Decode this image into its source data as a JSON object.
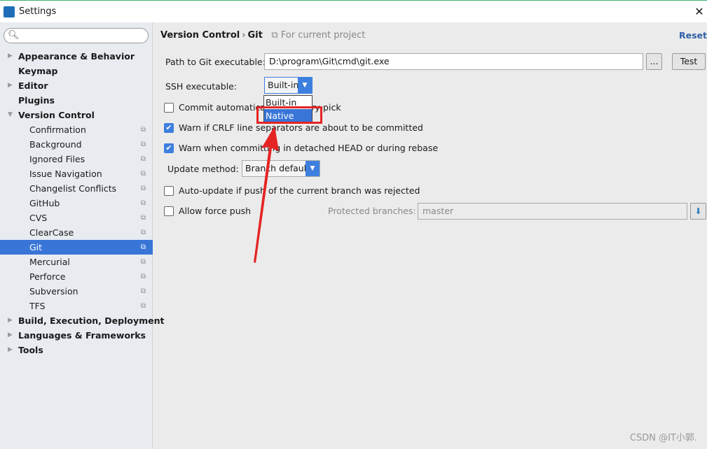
{
  "window": {
    "title": "Settings",
    "logo": "JI"
  },
  "search": {
    "placeholder": ""
  },
  "sidebar": {
    "items": [
      {
        "label": "Appearance & Behavior",
        "level": 0,
        "expand": "collapsed"
      },
      {
        "label": "Keymap",
        "level": 0
      },
      {
        "label": "Editor",
        "level": 0,
        "expand": "collapsed"
      },
      {
        "label": "Plugins",
        "level": 0
      },
      {
        "label": "Version Control",
        "level": 0,
        "expand": "expanded"
      },
      {
        "label": "Confirmation",
        "level": 1
      },
      {
        "label": "Background",
        "level": 1
      },
      {
        "label": "Ignored Files",
        "level": 1
      },
      {
        "label": "Issue Navigation",
        "level": 1
      },
      {
        "label": "Changelist Conflicts",
        "level": 1
      },
      {
        "label": "GitHub",
        "level": 1
      },
      {
        "label": "CVS",
        "level": 1
      },
      {
        "label": "ClearCase",
        "level": 1
      },
      {
        "label": "Git",
        "level": 1,
        "selected": true
      },
      {
        "label": "Mercurial",
        "level": 1
      },
      {
        "label": "Perforce",
        "level": 1
      },
      {
        "label": "Subversion",
        "level": 1
      },
      {
        "label": "TFS",
        "level": 1
      },
      {
        "label": "Build, Execution, Deployment",
        "level": 0,
        "expand": "collapsed"
      },
      {
        "label": "Languages & Frameworks",
        "level": 0,
        "expand": "collapsed"
      },
      {
        "label": "Tools",
        "level": 0,
        "expand": "collapsed"
      }
    ]
  },
  "main": {
    "breadcrumb": [
      "Version Control",
      "Git"
    ],
    "scope_hint": "For current project",
    "reset": "Reset",
    "path_label": "Path to Git executable:",
    "path_value": "D:\\program\\Git\\cmd\\git.exe",
    "browse": "...",
    "test": "Test",
    "ssh_label": "SSH executable:",
    "ssh_value": "Built-in",
    "ssh_options": [
      "Built-in",
      "Native"
    ],
    "ssh_highlighted": "Native",
    "cherry": {
      "label": "Commit automatically on cherry-pick",
      "checked": false
    },
    "crlf": {
      "label": "Warn if CRLF line separators are about to be committed",
      "checked": true
    },
    "detached": {
      "label": "Warn when committing in detached HEAD or during rebase",
      "checked": true
    },
    "update_label": "Update method:",
    "update_value": "Branch default",
    "autoupdate": {
      "label": "Auto-update if push of the current branch was rejected",
      "checked": false
    },
    "force": {
      "label": "Allow force push",
      "checked": false
    },
    "protected_label": "Protected branches:",
    "protected_value": "master"
  },
  "annotation": {
    "color": "#e52424"
  },
  "watermark": "CSDN @IT小郭.",
  "colors": {
    "accent": "#3875d7",
    "combo_button": "#3d7fde"
  }
}
